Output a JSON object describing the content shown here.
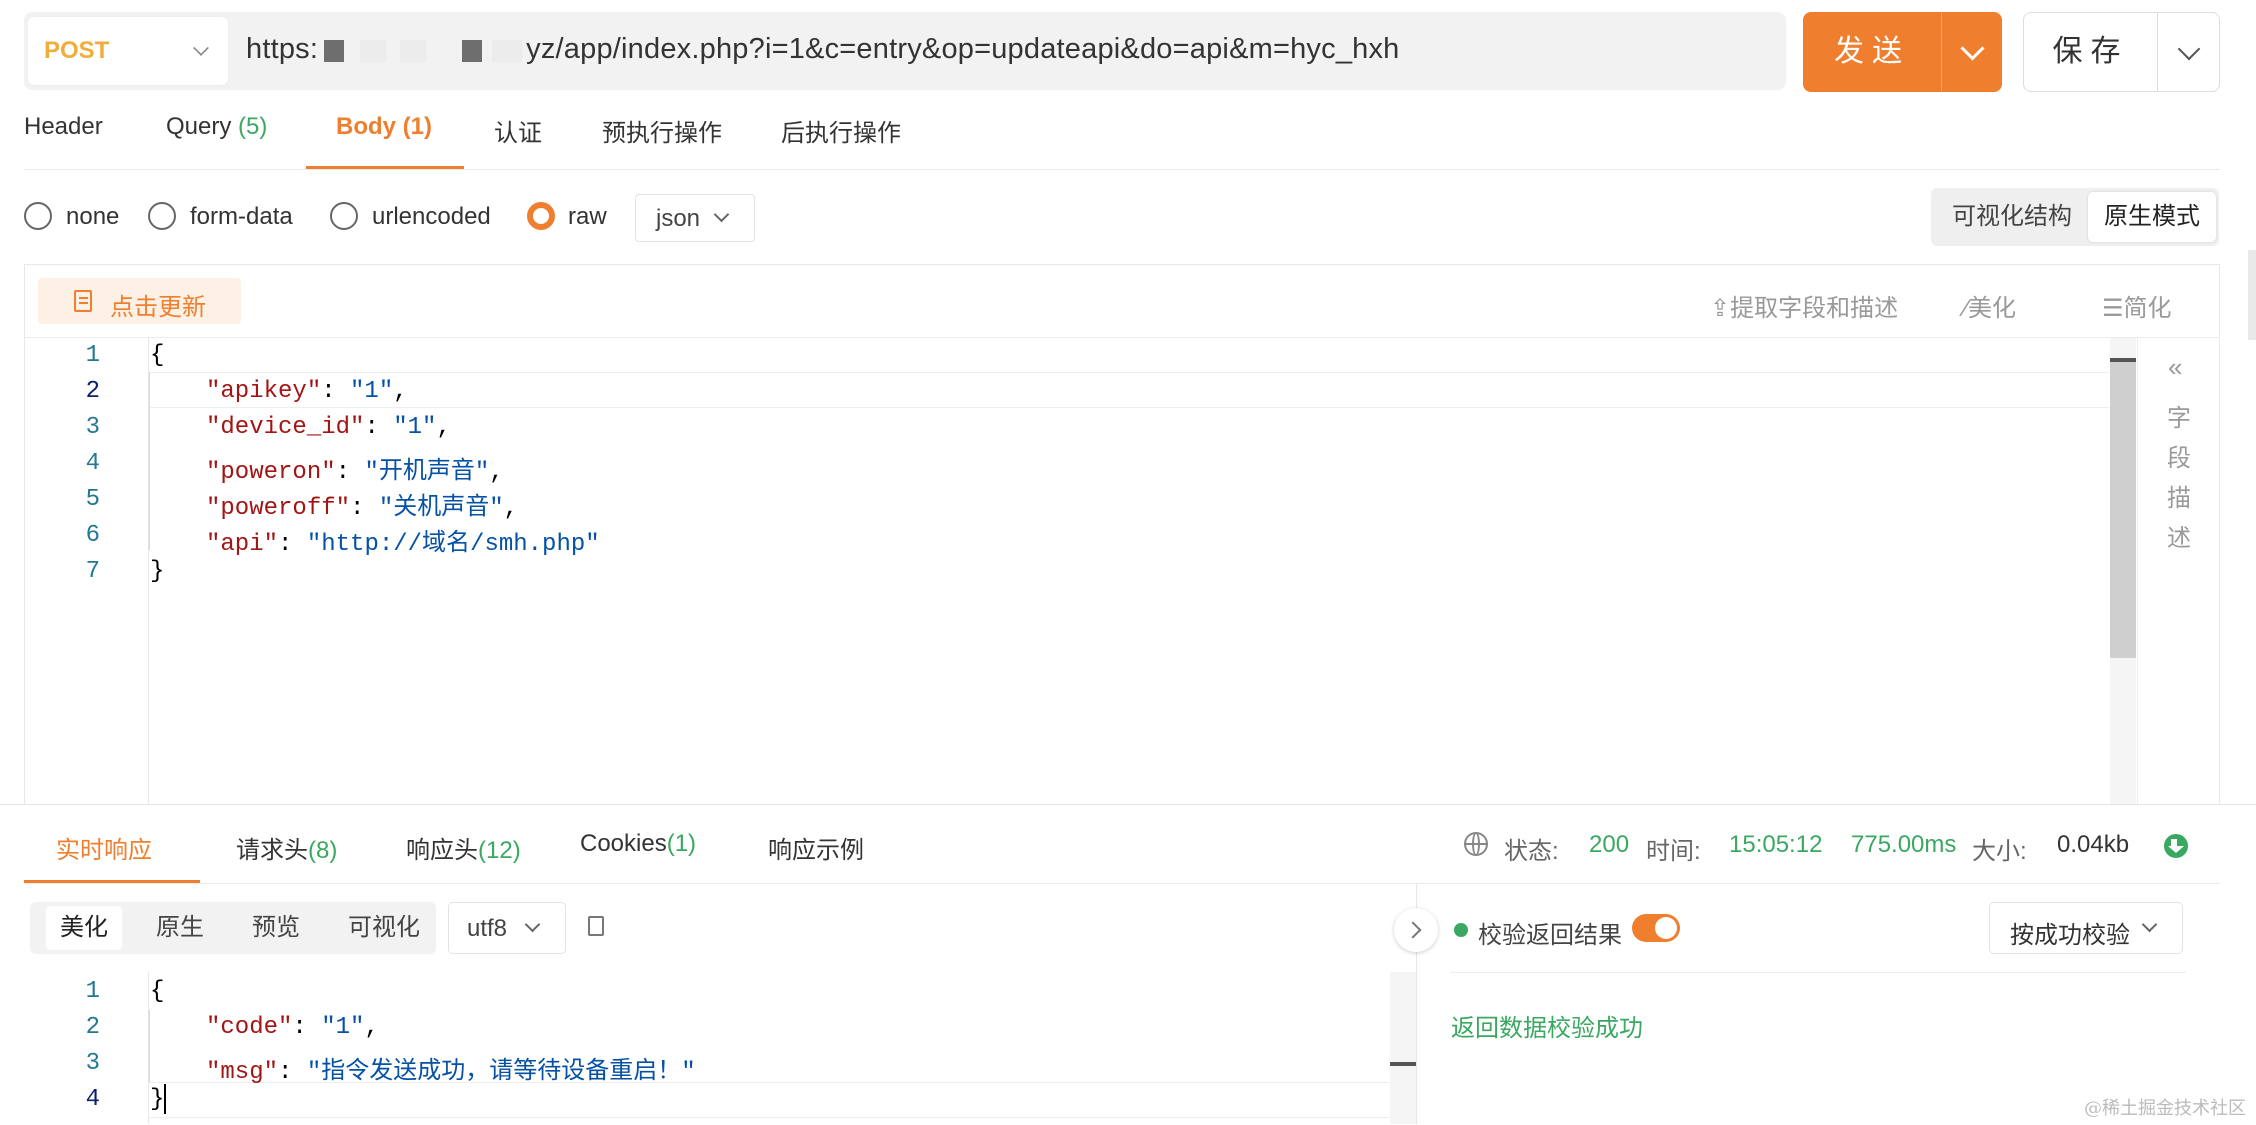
{
  "request": {
    "method": "POST",
    "url_prefix": "https:",
    "url_suffix": "yz/app/index.php?i=1&c=entry&op=updateapi&do=api&m=hyc_hxh",
    "send_label": "发送",
    "save_label": "保存"
  },
  "tabs": [
    {
      "label": "Header",
      "count": ""
    },
    {
      "label": "Query",
      "count": "(5)"
    },
    {
      "label": "Body",
      "count": "(1)"
    },
    {
      "label": "认证",
      "count": ""
    },
    {
      "label": "预执行操作",
      "count": ""
    },
    {
      "label": "后执行操作",
      "count": ""
    }
  ],
  "body_types": [
    "none",
    "form-data",
    "urlencoded",
    "raw"
  ],
  "selected_body_type": "raw",
  "raw_format": "json",
  "view_modes": [
    "可视化结构",
    "原生模式"
  ],
  "active_view_mode": "原生模式",
  "editor_toolbar": {
    "update": "点击更新",
    "extract": "提取字段和描述",
    "beautify": "美化",
    "simplify": "简化"
  },
  "request_code": {
    "line_numbers": [
      "1",
      "2",
      "3",
      "4",
      "5",
      "6",
      "7"
    ],
    "open": "{",
    "close": "}",
    "fields": [
      {
        "key": "\"apikey\"",
        "value": "\"1\"",
        "comma": ","
      },
      {
        "key": "\"device_id\"",
        "value": "\"1\"",
        "comma": ","
      },
      {
        "key": "\"poweron\"",
        "value": "\"开机声音\"",
        "comma": ","
      },
      {
        "key": "\"poweroff\"",
        "value": "\"关机声音\"",
        "comma": ","
      },
      {
        "key": "\"api\"",
        "value": "\"http://域名/smh.php\"",
        "comma": ""
      }
    ]
  },
  "side_panel_chars": [
    "字",
    "段",
    "描",
    "述"
  ],
  "response_tabs": [
    {
      "label": "实时响应",
      "count": ""
    },
    {
      "label": "请求头",
      "count": "(8)"
    },
    {
      "label": "响应头",
      "count": "(12)"
    },
    {
      "label": "Cookies",
      "count": "(1)"
    },
    {
      "label": "响应示例",
      "count": ""
    }
  ],
  "status": {
    "status_label": "状态:",
    "status_value": "200",
    "time_label": "时间:",
    "time_value": "15:05:12",
    "duration": "775.00ms",
    "size_label": "大小:",
    "size_value": "0.04kb"
  },
  "response_formats": [
    "美化",
    "原生",
    "预览",
    "可视化"
  ],
  "active_response_format": "美化",
  "encoding": "utf8",
  "response_code": {
    "line_numbers": [
      "1",
      "2",
      "3",
      "4"
    ],
    "open": "{",
    "close": "}",
    "fields": [
      {
        "key": "\"code\"",
        "value": "\"1\"",
        "comma": ","
      },
      {
        "key": "\"msg\"",
        "value": "\"指令发送成功，请等待设备重启！\"",
        "comma": ""
      }
    ]
  },
  "validation": {
    "label": "校验返回结果",
    "enabled": true,
    "mode": "按成功校验",
    "result": "返回数据校验成功"
  },
  "watermark": "@稀土掘金技术社区",
  "colors": {
    "accent": "#ef7f2e",
    "success": "#3aa861",
    "method": "#f0ad3c",
    "json_key": "#a31515",
    "json_string": "#0451a5"
  }
}
